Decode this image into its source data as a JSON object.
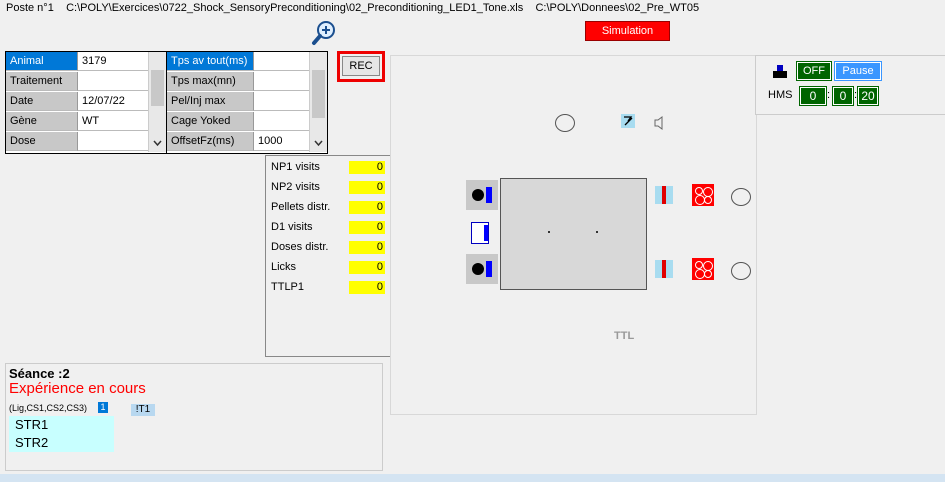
{
  "title": {
    "poste": "Poste n°1",
    "exercise_path": "C:\\POLY\\Exercices\\0722_Shock_SensoryPreconditioning\\02_Preconditioning_LED1_Tone.xls",
    "data_path": "C:\\POLY\\Donnees\\02_Pre_WT05"
  },
  "simulation_label": "Simulation",
  "rec_label": "REC",
  "info_grid": [
    {
      "label": "Animal",
      "value": "3179"
    },
    {
      "label": "Traitement",
      "value": ""
    },
    {
      "label": "Date",
      "value": "12/07/22"
    },
    {
      "label": "Gène",
      "value": "WT"
    },
    {
      "label": "Dose",
      "value": ""
    }
  ],
  "param_grid": [
    {
      "label": "Tps av tout(ms)",
      "value": ""
    },
    {
      "label": "Tps max(mn)",
      "value": ""
    },
    {
      "label": "Pel/Inj max",
      "value": ""
    },
    {
      "label": "Cage Yoked",
      "value": ""
    },
    {
      "label": "OffsetFz(ms)",
      "value": "1000"
    }
  ],
  "counters": [
    {
      "label": "NP1 visits",
      "value": "0"
    },
    {
      "label": "NP2 visits",
      "value": "0"
    },
    {
      "label": "Pellets distr.",
      "value": "0"
    },
    {
      "label": "D1 visits",
      "value": "0"
    },
    {
      "label": "Doses distr.",
      "value": "0"
    },
    {
      "label": "Licks",
      "value": "0"
    },
    {
      "label": "TTLP1",
      "value": "0"
    }
  ],
  "session": {
    "seance": "Séance :2",
    "status": "Expérience en cours",
    "lig_label": "(Lig,CS1,CS2,CS3)",
    "lig_badge": "1",
    "t1_label": "!T1",
    "str1": "STR1",
    "str2": "STR2"
  },
  "arena": {
    "ttl_label": "TTL"
  },
  "controls": {
    "off_label": "OFF",
    "pause_label": "Pause",
    "hms_label": "HMS",
    "hours": "0",
    "minutes": "0",
    "seconds": "20"
  },
  "colors": {
    "accent_red": "#ff0000",
    "counter_yellow": "#ffff00",
    "selected_blue": "#0078d7",
    "timer_green": "#006400",
    "pause_blue": "#3a96ff",
    "str_cyan": "#c8ffff"
  }
}
